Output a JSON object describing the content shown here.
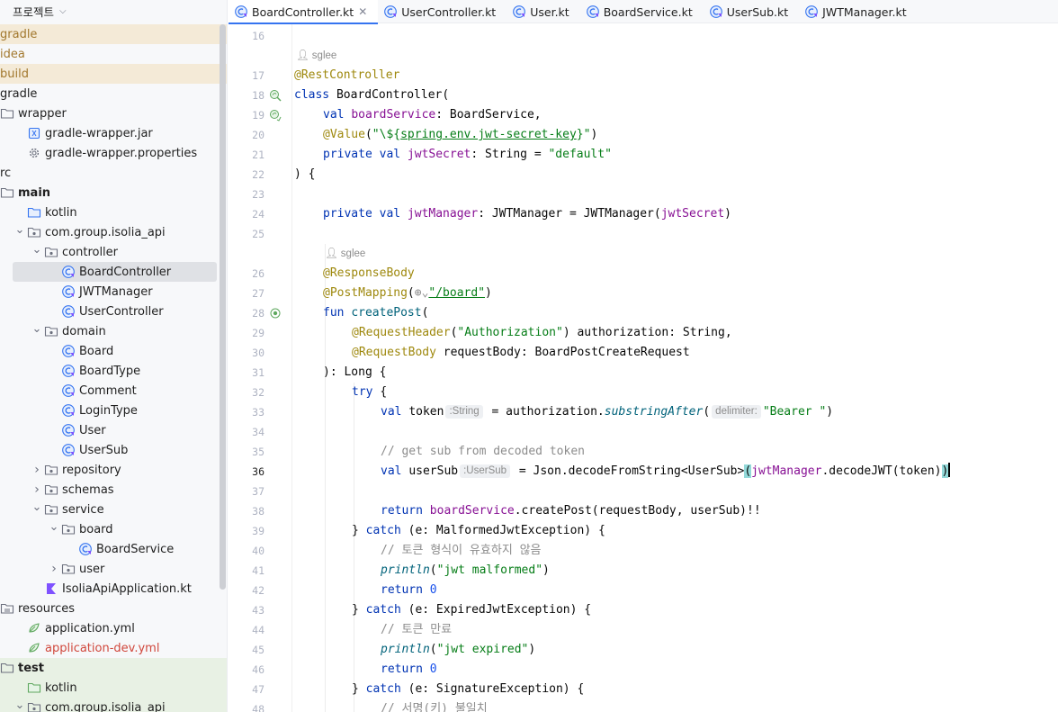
{
  "project": {
    "title": "프로젝트",
    "tree": [
      {
        "label": "gradle",
        "indent": 0,
        "icon": "none",
        "color": "orange",
        "bg": "orange",
        "arrow": "",
        "name": "tree-item-gradle-dot"
      },
      {
        "label": "idea",
        "indent": 0,
        "icon": "none",
        "color": "orange",
        "bg": "none",
        "arrow": "",
        "name": "tree-item-idea"
      },
      {
        "label": "build",
        "indent": 0,
        "icon": "none",
        "color": "orange",
        "bg": "orange",
        "arrow": "",
        "name": "tree-item-build"
      },
      {
        "label": "gradle",
        "indent": 0,
        "icon": "none",
        "color": "normal",
        "bg": "none",
        "arrow": "",
        "name": "tree-item-gradle"
      },
      {
        "label": "wrapper",
        "indent": 0,
        "icon": "folder",
        "color": "normal",
        "bg": "none",
        "arrow": "",
        "name": "tree-item-wrapper"
      },
      {
        "label": "gradle-wrapper.jar",
        "indent": 1,
        "icon": "jar",
        "color": "normal",
        "bg": "none",
        "arrow": "",
        "name": "tree-item-gradle-wrapper-jar"
      },
      {
        "label": "gradle-wrapper.properties",
        "indent": 1,
        "icon": "gear",
        "color": "normal",
        "bg": "none",
        "arrow": "",
        "name": "tree-item-gradle-wrapper-properties"
      },
      {
        "label": "rc",
        "indent": 0,
        "icon": "none",
        "color": "normal",
        "bg": "none",
        "arrow": "",
        "name": "tree-item-src"
      },
      {
        "label": "main",
        "indent": 0,
        "icon": "folder",
        "color": "bold",
        "bg": "none",
        "arrow": "",
        "name": "tree-item-main"
      },
      {
        "label": "kotlin",
        "indent": 1,
        "icon": "folder-blue",
        "color": "normal",
        "bg": "none",
        "arrow": "",
        "name": "tree-item-kotlin"
      },
      {
        "label": "com.group.isolia_api",
        "indent": 1,
        "icon": "package",
        "color": "normal",
        "bg": "none",
        "arrow": "down",
        "name": "tree-item-package"
      },
      {
        "label": "controller",
        "indent": 2,
        "icon": "package",
        "color": "normal",
        "bg": "none",
        "arrow": "down",
        "name": "tree-item-controller"
      },
      {
        "label": "BoardController",
        "indent": 3,
        "icon": "kclass",
        "color": "normal",
        "bg": "selected",
        "arrow": "",
        "name": "tree-item-boardcontroller"
      },
      {
        "label": "JWTManager",
        "indent": 3,
        "icon": "kclass",
        "color": "normal",
        "bg": "none",
        "arrow": "",
        "name": "tree-item-jwtmanager"
      },
      {
        "label": "UserController",
        "indent": 3,
        "icon": "kclass",
        "color": "normal",
        "bg": "none",
        "arrow": "",
        "name": "tree-item-usercontroller"
      },
      {
        "label": "domain",
        "indent": 2,
        "icon": "package",
        "color": "normal",
        "bg": "none",
        "arrow": "down",
        "name": "tree-item-domain"
      },
      {
        "label": "Board",
        "indent": 3,
        "icon": "kclass",
        "color": "normal",
        "bg": "none",
        "arrow": "",
        "name": "tree-item-board"
      },
      {
        "label": "BoardType",
        "indent": 3,
        "icon": "kclass",
        "color": "normal",
        "bg": "none",
        "arrow": "",
        "name": "tree-item-boardtype"
      },
      {
        "label": "Comment",
        "indent": 3,
        "icon": "kclass",
        "color": "normal",
        "bg": "none",
        "arrow": "",
        "name": "tree-item-comment"
      },
      {
        "label": "LoginType",
        "indent": 3,
        "icon": "kclass",
        "color": "normal",
        "bg": "none",
        "arrow": "",
        "name": "tree-item-logintype"
      },
      {
        "label": "User",
        "indent": 3,
        "icon": "kclass",
        "color": "normal",
        "bg": "none",
        "arrow": "",
        "name": "tree-item-user-class"
      },
      {
        "label": "UserSub",
        "indent": 3,
        "icon": "kclass",
        "color": "normal",
        "bg": "none",
        "arrow": "",
        "name": "tree-item-usersub"
      },
      {
        "label": "repository",
        "indent": 2,
        "icon": "package",
        "color": "normal",
        "bg": "none",
        "arrow": "right",
        "name": "tree-item-repository"
      },
      {
        "label": "schemas",
        "indent": 2,
        "icon": "package",
        "color": "normal",
        "bg": "none",
        "arrow": "right",
        "name": "tree-item-schemas"
      },
      {
        "label": "service",
        "indent": 2,
        "icon": "package",
        "color": "normal",
        "bg": "none",
        "arrow": "down",
        "name": "tree-item-service"
      },
      {
        "label": "board",
        "indent": 3,
        "icon": "package",
        "color": "normal",
        "bg": "none",
        "arrow": "down",
        "name": "tree-item-board-package"
      },
      {
        "label": "BoardService",
        "indent": 4,
        "icon": "kclass",
        "color": "normal",
        "bg": "none",
        "arrow": "",
        "name": "tree-item-boardservice"
      },
      {
        "label": "user",
        "indent": 3,
        "icon": "package",
        "color": "normal",
        "bg": "none",
        "arrow": "right",
        "name": "tree-item-user-package"
      },
      {
        "label": "IsoliaApiApplication.kt",
        "indent": 2,
        "icon": "kfile",
        "color": "normal",
        "bg": "none",
        "arrow": "",
        "name": "tree-item-application-kt"
      },
      {
        "label": "resources",
        "indent": 0,
        "icon": "resources",
        "color": "normal",
        "bg": "none",
        "arrow": "",
        "name": "tree-item-resources"
      },
      {
        "label": "application.yml",
        "indent": 1,
        "icon": "yml",
        "color": "normal",
        "bg": "none",
        "arrow": "",
        "name": "tree-item-application-yml"
      },
      {
        "label": "application-dev.yml",
        "indent": 1,
        "icon": "yml",
        "color": "red",
        "bg": "none",
        "arrow": "",
        "name": "tree-item-application-dev-yml"
      },
      {
        "label": "test",
        "indent": 0,
        "icon": "folder",
        "color": "bold",
        "bg": "green",
        "arrow": "",
        "name": "tree-item-test"
      },
      {
        "label": "kotlin",
        "indent": 1,
        "icon": "folder-green",
        "color": "normal",
        "bg": "green",
        "arrow": "",
        "name": "tree-item-test-kotlin"
      },
      {
        "label": "com.group.isolia_api",
        "indent": 1,
        "icon": "package",
        "color": "normal",
        "bg": "green",
        "arrow": "down",
        "name": "tree-item-test-package"
      }
    ]
  },
  "tabs": [
    {
      "label": "BoardController.kt",
      "active": true
    },
    {
      "label": "UserController.kt",
      "active": false
    },
    {
      "label": "User.kt",
      "active": false
    },
    {
      "label": "BoardService.kt",
      "active": false
    },
    {
      "label": "UserSub.kt",
      "active": false
    },
    {
      "label": "JWTManager.kt",
      "active": false
    }
  ],
  "editor": {
    "author": "sglee",
    "current_line": "36",
    "lines": [
      {
        "n": "16",
        "indent": 0,
        "tokens": []
      },
      {
        "author": true,
        "indent": 0
      },
      {
        "n": "17",
        "indent": 0,
        "tokens": [
          [
            "an",
            "@RestController"
          ]
        ]
      },
      {
        "n": "18",
        "indent": 0,
        "gutter": "bean",
        "tokens": [
          [
            "kw",
            "class "
          ],
          [
            "",
            "BoardController("
          ]
        ]
      },
      {
        "n": "19",
        "indent": 1,
        "gutter": "bean2",
        "tokens": [
          [
            "kw",
            "val "
          ],
          [
            "prop",
            "boardService"
          ],
          [
            "",
            ": BoardService,"
          ]
        ]
      },
      {
        "n": "20",
        "indent": 1,
        "tokens": [
          [
            "an",
            "@Value"
          ],
          [
            "",
            "("
          ],
          [
            "str",
            "\"\\${"
          ],
          [
            "link",
            "spring.env.jwt-secret-key"
          ],
          [
            "str",
            "}\""
          ],
          [
            "",
            ")"
          ]
        ]
      },
      {
        "n": "21",
        "indent": 1,
        "tokens": [
          [
            "kw",
            "private val "
          ],
          [
            "prop",
            "jwtSecret"
          ],
          [
            "",
            ": String = "
          ],
          [
            "str",
            "\"default\""
          ]
        ]
      },
      {
        "n": "22",
        "indent": 0,
        "tokens": [
          [
            "",
            ") {"
          ]
        ]
      },
      {
        "n": "23",
        "indent": 0,
        "tokens": []
      },
      {
        "n": "24",
        "indent": 1,
        "tokens": [
          [
            "kw",
            "private val "
          ],
          [
            "prop",
            "jwtManager"
          ],
          [
            "",
            ": JWTManager = JWTManager("
          ],
          [
            "prop",
            "jwtSecret"
          ],
          [
            "",
            ")"
          ]
        ]
      },
      {
        "n": "25",
        "indent": 0,
        "tokens": []
      },
      {
        "author": true,
        "indent": 1
      },
      {
        "n": "26",
        "indent": 1,
        "tokens": [
          [
            "an",
            "@ResponseBody"
          ]
        ]
      },
      {
        "n": "27",
        "indent": 1,
        "tokens": [
          [
            "an",
            "@PostMapping"
          ],
          [
            "",
            "("
          ],
          [
            "cm",
            "⊕⌄"
          ],
          [
            "link",
            "\"/board\""
          ],
          [
            "",
            ")"
          ]
        ]
      },
      {
        "n": "28",
        "indent": 1,
        "gutter": "web",
        "tokens": [
          [
            "kw",
            "fun "
          ],
          [
            "fn",
            "createPost"
          ],
          [
            "",
            "("
          ]
        ]
      },
      {
        "n": "29",
        "indent": 2,
        "tokens": [
          [
            "an",
            "@RequestHeader"
          ],
          [
            "",
            "("
          ],
          [
            "str",
            "\"Authorization\""
          ],
          [
            "",
            ") authorization: String,"
          ]
        ]
      },
      {
        "n": "30",
        "indent": 2,
        "tokens": [
          [
            "an",
            "@RequestBody "
          ],
          [
            "",
            "requestBody: BoardPostCreateRequest"
          ]
        ]
      },
      {
        "n": "31",
        "indent": 1,
        "tokens": [
          [
            "",
            "): Long {"
          ]
        ]
      },
      {
        "n": "32",
        "indent": 2,
        "tokens": [
          [
            "kw",
            "try "
          ],
          [
            "",
            "{"
          ]
        ]
      },
      {
        "n": "33",
        "indent": 3,
        "tokens": [
          [
            "kw",
            "val "
          ],
          [
            "",
            "token"
          ],
          [
            "hint",
            ":String"
          ],
          [
            "",
            " = authorization."
          ],
          [
            "fn-i",
            "substringAfter"
          ],
          [
            "",
            "("
          ],
          [
            "hint",
            "delimiter:"
          ],
          [
            "str",
            "\"Bearer \""
          ],
          [
            "",
            ")"
          ]
        ]
      },
      {
        "n": "34",
        "indent": 0,
        "tokens": []
      },
      {
        "n": "35",
        "indent": 3,
        "tokens": [
          [
            "cm",
            "// get sub from decoded token"
          ]
        ]
      },
      {
        "n": "36",
        "indent": 3,
        "bulb": true,
        "tokens": [
          [
            "kw",
            "val "
          ],
          [
            "",
            "userSub"
          ],
          [
            "hint",
            ":UserSub"
          ],
          [
            "",
            " = Json.decodeFromString<UserSub>"
          ],
          [
            "paren",
            "("
          ],
          [
            "prop",
            "jwtManager"
          ],
          [
            "",
            ".decodeJWT(token)"
          ],
          [
            "paren",
            ")"
          ],
          [
            "caret",
            ""
          ]
        ]
      },
      {
        "n": "37",
        "indent": 0,
        "tokens": []
      },
      {
        "n": "38",
        "indent": 3,
        "tokens": [
          [
            "kw",
            "return "
          ],
          [
            "prop",
            "boardService"
          ],
          [
            "",
            ".createPost(requestBody, userSub)!!"
          ]
        ]
      },
      {
        "n": "39",
        "indent": 2,
        "tokens": [
          [
            "",
            "} "
          ],
          [
            "kw",
            "catch "
          ],
          [
            "",
            "(e: MalformedJwtException) {"
          ]
        ]
      },
      {
        "n": "40",
        "indent": 3,
        "tokens": [
          [
            "cm",
            "// 토큰 형식이 유효하지 않음"
          ]
        ]
      },
      {
        "n": "41",
        "indent": 3,
        "tokens": [
          [
            "fn-i",
            "println"
          ],
          [
            "",
            "("
          ],
          [
            "str",
            "\"jwt malformed\""
          ],
          [
            "",
            ")"
          ]
        ]
      },
      {
        "n": "42",
        "indent": 3,
        "tokens": [
          [
            "kw",
            "return "
          ],
          [
            "num",
            "0"
          ]
        ]
      },
      {
        "n": "43",
        "indent": 2,
        "tokens": [
          [
            "",
            "} "
          ],
          [
            "kw",
            "catch "
          ],
          [
            "",
            "(e: ExpiredJwtException) {"
          ]
        ]
      },
      {
        "n": "44",
        "indent": 3,
        "tokens": [
          [
            "cm",
            "// 토큰 만료"
          ]
        ]
      },
      {
        "n": "45",
        "indent": 3,
        "tokens": [
          [
            "fn-i",
            "println"
          ],
          [
            "",
            "("
          ],
          [
            "str",
            "\"jwt expired\""
          ],
          [
            "",
            ")"
          ]
        ]
      },
      {
        "n": "46",
        "indent": 3,
        "tokens": [
          [
            "kw",
            "return "
          ],
          [
            "num",
            "0"
          ]
        ]
      },
      {
        "n": "47",
        "indent": 2,
        "tokens": [
          [
            "",
            "} "
          ],
          [
            "kw",
            "catch "
          ],
          [
            "",
            "(e: SignatureException) {"
          ]
        ]
      },
      {
        "n": "48",
        "indent": 3,
        "tokens": [
          [
            "cm",
            "// 서명(키) 불일치"
          ]
        ]
      }
    ]
  },
  "colors": {
    "accent": "#3574f0",
    "keyword": "#0033b3",
    "annotation": "#9e880d",
    "string": "#067d17",
    "property": "#871094"
  }
}
